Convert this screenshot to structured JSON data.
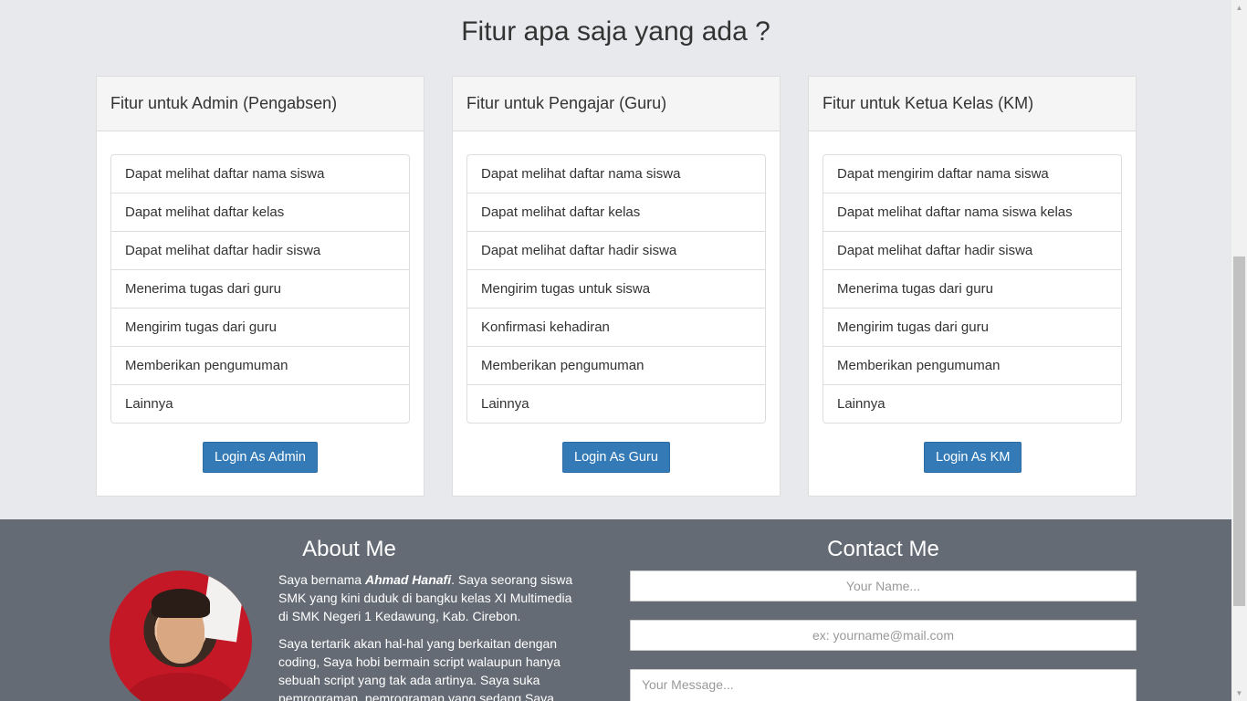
{
  "features": {
    "title": "Fitur apa saja yang ada ?",
    "panels": [
      {
        "heading": "Fitur untuk Admin (Pengabsen)",
        "items": [
          "Dapat melihat daftar nama siswa",
          "Dapat melihat daftar kelas",
          "Dapat melihat daftar hadir siswa",
          "Menerima tugas dari guru",
          "Mengirim tugas dari guru",
          "Memberikan pengumuman",
          "Lainnya"
        ],
        "button": "Login As Admin"
      },
      {
        "heading": "Fitur untuk Pengajar (Guru)",
        "items": [
          "Dapat melihat daftar nama siswa",
          "Dapat melihat daftar kelas",
          "Dapat melihat daftar hadir siswa",
          "Mengirim tugas untuk siswa",
          "Konfirmasi kehadiran",
          "Memberikan pengumuman",
          "Lainnya"
        ],
        "button": "Login As Guru"
      },
      {
        "heading": "Fitur untuk Ketua Kelas (KM)",
        "items": [
          "Dapat mengirim daftar nama siswa",
          "Dapat melihat daftar nama siswa kelas",
          "Dapat melihat daftar hadir siswa",
          "Menerima tugas dari guru",
          "Mengirim tugas dari guru",
          "Memberikan pengumuman",
          "Lainnya"
        ],
        "button": "Login As KM"
      }
    ]
  },
  "about": {
    "title": "About Me",
    "p1_before": "Saya bernama ",
    "name": "Ahmad Hanafi",
    "p1_after": ". Saya seorang siswa SMK yang kini duduk di bangku kelas XI Multimedia di SMK Negeri 1 Kedawung, Kab. Cirebon.",
    "p2": "Saya tertarik akan hal-hal yang berkaitan dengan coding, Saya hobi bermain script walaupun hanya sebuah script yang tak ada artinya. Saya suka pemrograman, pemrograman yang sedang Saya"
  },
  "contact": {
    "title": "Contact Me",
    "name_placeholder": "Your Name...",
    "email_placeholder": "ex: yourname@mail.com",
    "message_placeholder": "Your Message..."
  },
  "colors": {
    "primary": "#337ab7",
    "footer_bg": "#656b75",
    "page_bg": "#e8e9ec"
  }
}
